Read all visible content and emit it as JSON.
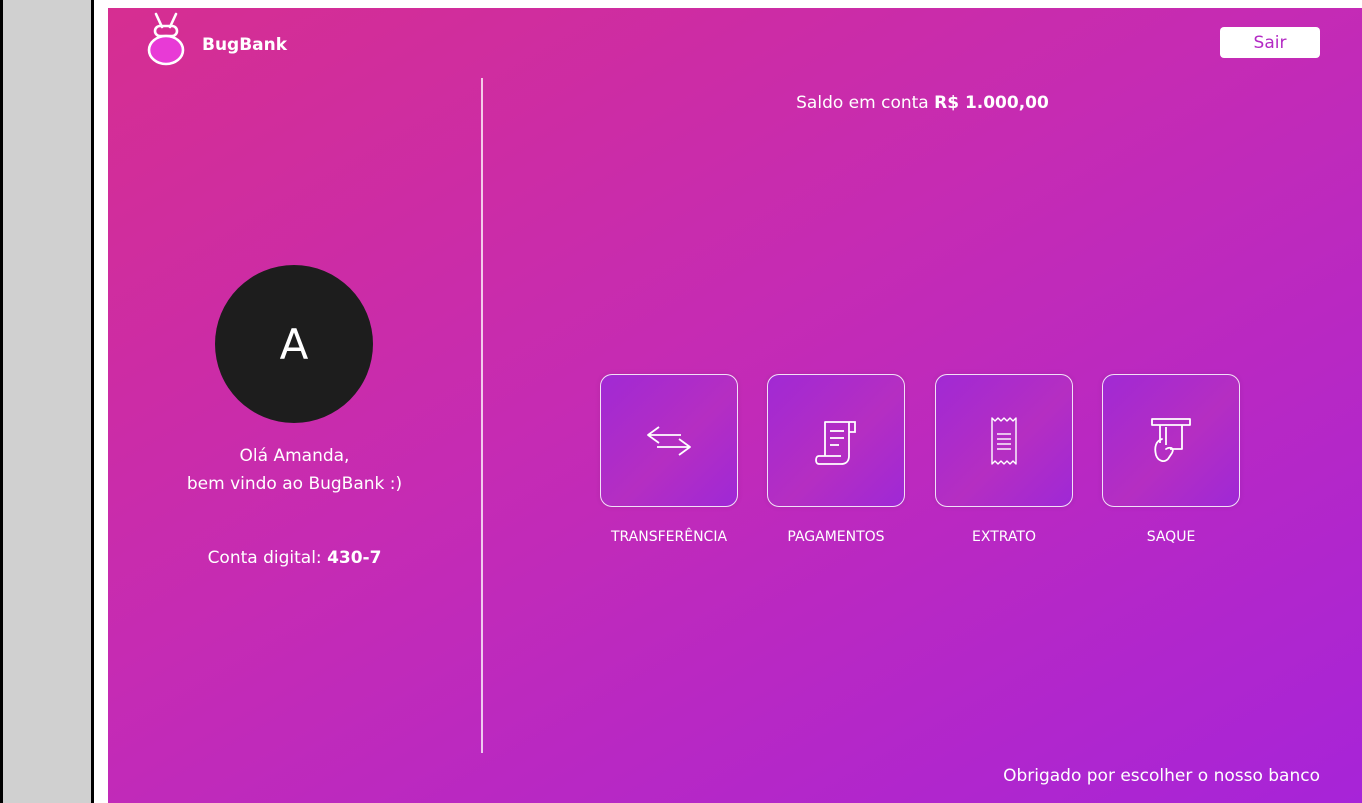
{
  "brand": {
    "name": "BugBank"
  },
  "header": {
    "logout_label": "Sair"
  },
  "balance": {
    "prefix": "Saldo em conta ",
    "amount": "R$ 1.000,00"
  },
  "user": {
    "avatar_initial": "A",
    "greeting_line1": "Olá Amanda,",
    "greeting_line2": "bem vindo ao BugBank :)",
    "account_label": "Conta digital: ",
    "account_number": "430-7"
  },
  "actions": [
    {
      "label": "TRANSFERÊNCIA",
      "icon": "transfer-arrows-icon"
    },
    {
      "label": "PAGAMENTOS",
      "icon": "payment-scroll-icon"
    },
    {
      "label": "EXTRATO",
      "icon": "receipt-icon"
    },
    {
      "label": "SAQUE",
      "icon": "atm-withdraw-icon"
    }
  ],
  "footer": {
    "text": "Obrigado por escolher o nosso banco"
  },
  "colors": {
    "gradient_start": "#d62e91",
    "gradient_end": "#a724d8",
    "avatar_bg": "#1d1d1d",
    "button_text": "#b329c4"
  }
}
